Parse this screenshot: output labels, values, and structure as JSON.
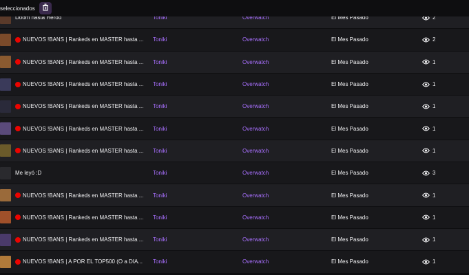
{
  "toolbar": {
    "selected_label": "seleccionados",
    "delete_icon": "trash-icon"
  },
  "colors": {
    "accent": "#a970ff",
    "live": "#eb0400",
    "row_odd": "#1f1f23",
    "row_even": "#18181b"
  },
  "rows": [
    {
      "title": "Doom hasta Herod",
      "live": false,
      "creator": "Toniki",
      "category": "Overwatch",
      "date": "El Mes Pasado",
      "views": "2",
      "thumb": "#5a3a2a"
    },
    {
      "title": "NUEVOS !BANS | Rankeds en MASTER hasta ...",
      "live": true,
      "creator": "Toniki",
      "category": "Overwatch",
      "date": "El Mes Pasado",
      "views": "2",
      "thumb": "#7a4a2a"
    },
    {
      "title": "NUEVOS !BANS | Rankeds en MASTER hasta ...",
      "live": true,
      "creator": "Toniki",
      "category": "Overwatch",
      "date": "El Mes Pasado",
      "views": "1",
      "thumb": "#8a5a30"
    },
    {
      "title": "NUEVOS !BANS | Rankeds en MASTER hasta ...",
      "live": true,
      "creator": "Toniki",
      "category": "Overwatch",
      "date": "El Mes Pasado",
      "views": "1",
      "thumb": "#3a3a5a"
    },
    {
      "title": "NUEVOS !BANS | Rankeds en MASTER hasta ...",
      "live": true,
      "creator": "Toniki",
      "category": "Overwatch",
      "date": "El Mes Pasado",
      "views": "1",
      "thumb": "#2a2a3a"
    },
    {
      "title": "NUEVOS !BANS | Rankeds en MASTER hasta ...",
      "live": true,
      "creator": "Toniki",
      "category": "Overwatch",
      "date": "El Mes Pasado",
      "views": "1",
      "thumb": "#5a4a7a"
    },
    {
      "title": "NUEVOS !BANS | Rankeds en MASTER hasta ...",
      "live": true,
      "creator": "Toniki",
      "category": "Overwatch",
      "date": "El Mes Pasado",
      "views": "1",
      "thumb": "#6a5a2a"
    },
    {
      "title": "Me leyó :D",
      "live": false,
      "creator": "Toniki",
      "category": "Overwatch",
      "date": "El Mes Pasado",
      "views": "3",
      "thumb": "#2a2a2e"
    },
    {
      "title": "NUEVOS !BANS | Rankeds en MASTER hasta ...",
      "live": true,
      "creator": "Toniki",
      "category": "Overwatch",
      "date": "El Mes Pasado",
      "views": "1",
      "thumb": "#9a6a3a"
    },
    {
      "title": "NUEVOS !BANS | Rankeds en MASTER hasta ...",
      "live": true,
      "creator": "Toniki",
      "category": "Overwatch",
      "date": "El Mes Pasado",
      "views": "1",
      "thumb": "#a0502a"
    },
    {
      "title": "NUEVOS !BANS | Rankeds en MASTER hasta ...",
      "live": true,
      "creator": "Toniki",
      "category": "Overwatch",
      "date": "El Mes Pasado",
      "views": "1",
      "thumb": "#4a3a6a"
    },
    {
      "title": "NUEVOS !BANS | A POR EL TOP500 (O a DIA...",
      "live": true,
      "creator": "Toniki",
      "category": "Overwatch",
      "date": "El Mes Pasado",
      "views": "1",
      "thumb": "#b07a3a"
    }
  ]
}
